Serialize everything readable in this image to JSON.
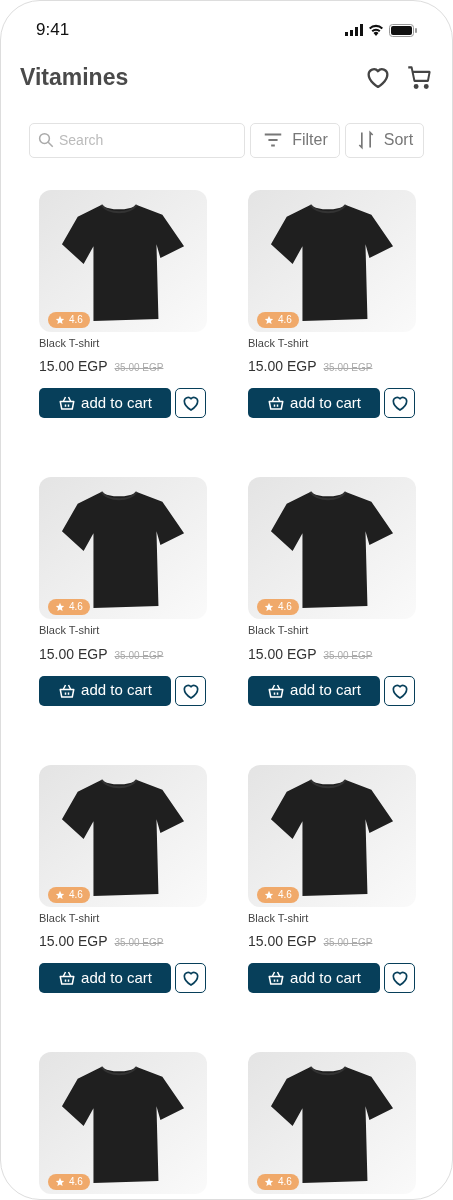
{
  "status_bar": {
    "time": "9:41"
  },
  "header": {
    "title": "Vitamines"
  },
  "search": {
    "placeholder": "Search"
  },
  "toolbar": {
    "filter": "Filter",
    "sort": "Sort"
  },
  "products": [
    {
      "rating": "4.6",
      "name": "Black T-shirt",
      "price": "15.00 EGP",
      "old_price": "35.00 EGP",
      "cart_label": "add to cart",
      "favorite": false
    },
    {
      "rating": "4.6",
      "name": "Black T-shirt",
      "price": "15.00 EGP",
      "old_price": "35.00 EGP",
      "cart_label": "add to cart",
      "favorite": false
    },
    {
      "rating": "4.6",
      "name": "Black T-shirt",
      "price": "15.00 EGP",
      "old_price": "35.00 EGP",
      "cart_label": "add to cart",
      "favorite": false
    },
    {
      "rating": "4.6",
      "name": "Black T-shirt",
      "price": "15.00 EGP",
      "old_price": "35.00 EGP",
      "cart_label": "add to cart",
      "favorite": false
    },
    {
      "rating": "4.6",
      "name": "Black T-shirt",
      "price": "15.00 EGP",
      "old_price": "35.00 EGP",
      "cart_label": "add to cart",
      "favorite": false
    },
    {
      "rating": "4.6",
      "name": "Black T-shirt",
      "price": "15.00 EGP",
      "old_price": "35.00 EGP",
      "cart_label": "add to cart",
      "favorite": false
    },
    {
      "rating": "4.6"
    },
    {
      "rating": "4.6"
    }
  ]
}
